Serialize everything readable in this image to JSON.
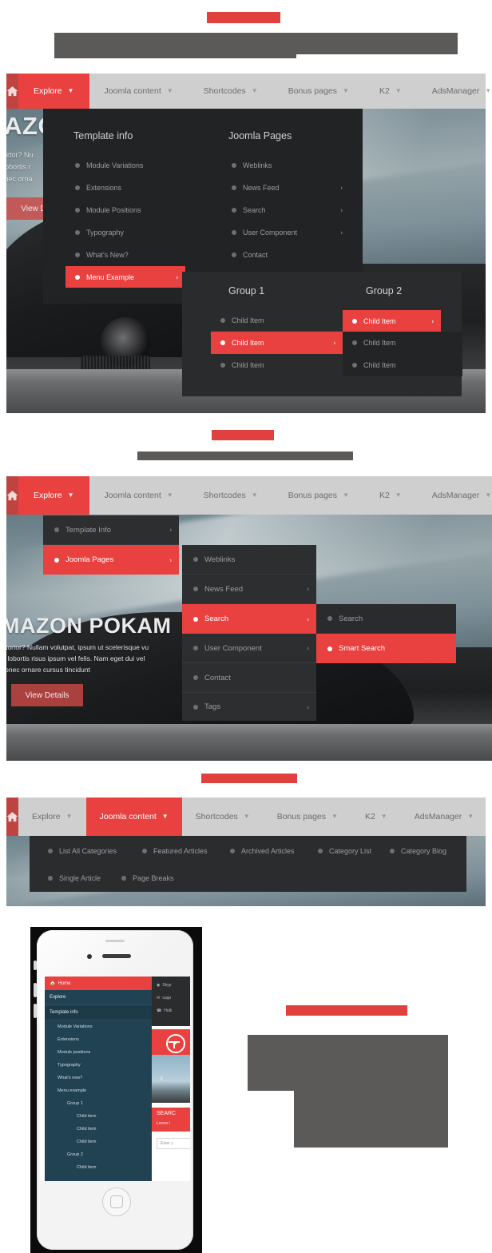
{
  "brand": {
    "accent_red": "#e8413f",
    "dark_red": "#bf4441",
    "panel_dark": "#222324",
    "nav_gray": "#cfcfcf",
    "redact_gray": "#5b5a58"
  },
  "nav": {
    "home_icon": "home-icon",
    "caret_icon": "chevron-down-icon",
    "items": [
      {
        "label": "Explore"
      },
      {
        "label": "Joomla content"
      },
      {
        "label": "Shortcodes"
      },
      {
        "label": "Bonus pages"
      },
      {
        "label": "K2"
      },
      {
        "label": "AdsManager"
      }
    ]
  },
  "hero": {
    "title": "MAZON POKAM",
    "line1": "n tortor? Nullam volutpat, ipsum ut scelerisque vu",
    "line2": "et lobortis risus ipsum vel felis. Nam eget dui vel",
    "line3": "Donec ornare cursus tincidunt",
    "button": "View Details",
    "title_short": "IAZO",
    "line1_short": "n tortor? Nu",
    "line2_short": "et lobortis r",
    "line3_short": "Donec orna",
    "button_short": "View D"
  },
  "section1": {
    "col1_title": "Template info",
    "col1_items": [
      {
        "label": "Module Variations",
        "arrow": false,
        "selected": false
      },
      {
        "label": "Extensions",
        "arrow": false,
        "selected": false
      },
      {
        "label": "Module Positions",
        "arrow": false,
        "selected": false
      },
      {
        "label": "Typography",
        "arrow": false,
        "selected": false
      },
      {
        "label": "What's New?",
        "arrow": false,
        "selected": false
      },
      {
        "label": "Menu Example",
        "arrow": true,
        "selected": true
      }
    ],
    "col2_title": "Joomla Pages",
    "col2_items": [
      {
        "label": "Weblinks",
        "arrow": false,
        "selected": false
      },
      {
        "label": "News Feed",
        "arrow": true,
        "selected": false
      },
      {
        "label": "Search",
        "arrow": true,
        "selected": false
      },
      {
        "label": "User Component",
        "arrow": true,
        "selected": false
      },
      {
        "label": "Contact",
        "arrow": false,
        "selected": false
      }
    ],
    "group1_title": "Group 1",
    "group1_items": [
      {
        "label": "Child Item",
        "arrow": false,
        "selected": false
      },
      {
        "label": "Child Item",
        "arrow": true,
        "selected": true
      },
      {
        "label": "Child Item",
        "arrow": false,
        "selected": false
      }
    ],
    "group2_title": "Group 2",
    "group2_items": [
      {
        "label": "Child Item",
        "arrow": true,
        "selected": true
      },
      {
        "label": "Child Item",
        "arrow": false,
        "selected": false
      },
      {
        "label": "Child Item",
        "arrow": false,
        "selected": false
      }
    ]
  },
  "section2": {
    "level1": [
      {
        "label": "Template Info",
        "arrow": true,
        "selected": false
      },
      {
        "label": "Joomla Pages",
        "arrow": true,
        "selected": true
      }
    ],
    "level2": [
      {
        "label": "Weblinks",
        "arrow": false,
        "selected": false
      },
      {
        "label": "News Feed",
        "arrow": true,
        "selected": false
      },
      {
        "label": "Search",
        "arrow": true,
        "selected": true
      },
      {
        "label": "User Component",
        "arrow": true,
        "selected": false
      },
      {
        "label": "Contact",
        "arrow": false,
        "selected": false
      },
      {
        "label": "Tags",
        "arrow": true,
        "selected": false
      }
    ],
    "level3": [
      {
        "label": "Search",
        "arrow": false,
        "selected": false
      },
      {
        "label": "Smart Search",
        "arrow": false,
        "selected": true
      }
    ]
  },
  "section3": {
    "row1": [
      "List All Categories",
      "Featured Articles",
      "Archived Articles",
      "Category List",
      "Category Blog"
    ],
    "row2": [
      "Single Article",
      "Page Breaks"
    ]
  },
  "mobile": {
    "home": "Home",
    "home_icon": "home-icon",
    "explore": "Explore",
    "template_info": "Template info",
    "sub_items": [
      "Module Variations",
      "Extensions",
      "Module positions",
      "Typography",
      "What's new?"
    ],
    "menu_example": "Menu example",
    "group1": "Group 1",
    "group1_children": [
      "Child item",
      "Child item",
      "Child item"
    ],
    "group2": "Group 2",
    "group2_children": [
      "Child item"
    ],
    "contact": [
      {
        "icon": "skype-icon",
        "label": "Skyp"
      },
      {
        "icon": "mail-icon",
        "label": "supp"
      },
      {
        "icon": "phone-icon",
        "label": "Hotli"
      }
    ],
    "search_heading": "SEARC",
    "search_sub": "Lorem i",
    "input_placeholder": "Enter y",
    "logo_icon": "steering-wheel-icon",
    "slider_prev_icon": "chevron-left-icon"
  }
}
